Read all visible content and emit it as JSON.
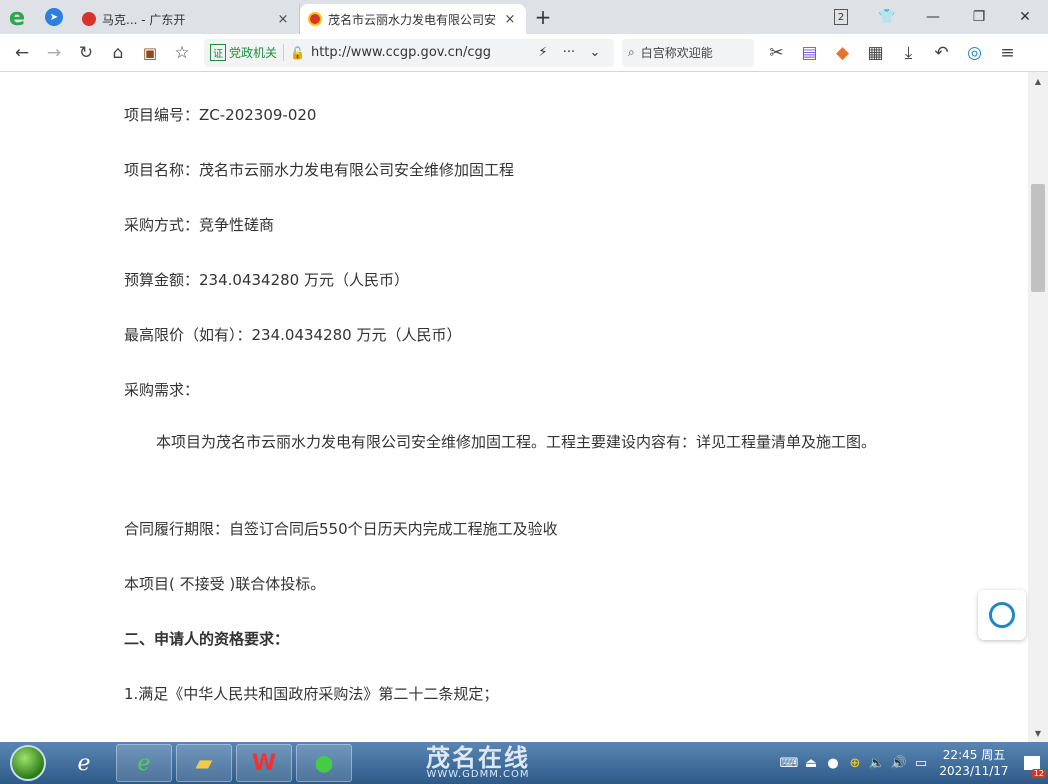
{
  "browser": {
    "tabs": [
      {
        "title": "马克...  - 广东开",
        "close": "×"
      },
      {
        "title": "茂名市云丽水力发电有限公司安",
        "close": "×"
      }
    ],
    "new_tab": "+",
    "tab_count": "2",
    "address": {
      "cert_label": "党政机关",
      "cert_icon": "证",
      "url": "http://www.ccgp.gov.cn/cgg",
      "more": "···"
    },
    "search_placeholder": "白宫称欢迎能"
  },
  "content": {
    "paragraphs": [
      "项目编号：ZC-202309-020",
      "项目名称：茂名市云丽水力发电有限公司安全维修加固工程",
      "采购方式：竞争性磋商",
      "预算金额：234.0434280 万元（人民币）",
      "最高限价（如有）：234.0434280 万元（人民币）",
      "采购需求：",
      "本项目为茂名市云丽水力发电有限公司安全维修加固工程。工程主要建设内容有：详见工程量清单及施工图。",
      "合同履行期限：自签订合同后550个日历天内完成工程施工及验收",
      "本项目( 不接受 )联合体投标。",
      "二、申请人的资格要求：",
      "1.满足《中华人民共和国政府采购法》第二十二条规定；"
    ]
  },
  "taskbar": {
    "watermark_big": "茂名在线",
    "watermark_small": "WWW.GDMM.COM",
    "time": "22:45 周五",
    "date": "2023/11/17",
    "notification_count": "12"
  }
}
